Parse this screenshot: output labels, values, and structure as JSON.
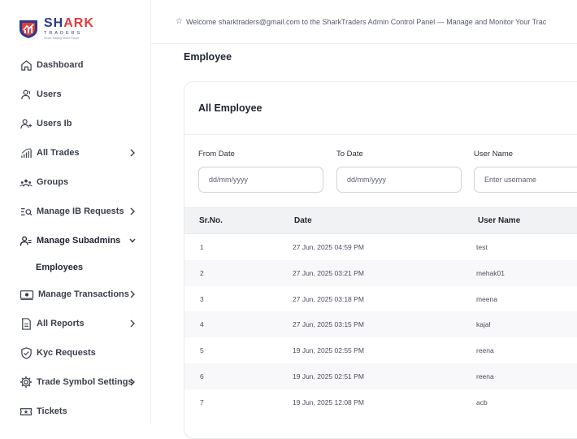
{
  "brand": {
    "title_a": "SH",
    "title_b": "ARK",
    "subtitle": "TRADERS",
    "tagline": "Smart Trading Smart Future"
  },
  "sidebar": {
    "items": [
      {
        "label": "Dashboard",
        "icon": "home-icon",
        "chevron": false
      },
      {
        "label": "Users",
        "icon": "users-icon",
        "chevron": false
      },
      {
        "label": "Users Ib",
        "icon": "user-add-icon",
        "chevron": false
      },
      {
        "label": "All Trades",
        "icon": "bar-chart-icon",
        "chevron": true
      },
      {
        "label": "Groups",
        "icon": "groups-icon",
        "chevron": false
      },
      {
        "label": "Manage IB Requests",
        "icon": "list-search-icon",
        "chevron": true
      },
      {
        "label": "Manage Subadmins",
        "icon": "subadmin-icon",
        "chevron": "down"
      },
      {
        "label": "Employees",
        "icon": "",
        "chevron": false,
        "sub": true
      },
      {
        "label": "Manage Transactions",
        "icon": "money-icon",
        "chevron": true
      },
      {
        "label": "All Reports",
        "icon": "document-icon",
        "chevron": true
      },
      {
        "label": "Kyc Requests",
        "icon": "shield-check-icon",
        "chevron": false
      },
      {
        "label": "Trade Symbol Settings",
        "icon": "gear-icon",
        "chevron": true
      },
      {
        "label": "Tickets",
        "icon": "ticket-icon",
        "chevron": false
      }
    ]
  },
  "topbar": {
    "message": "Welcome sharktraders@gmail.com to the SharkTraders Admin Control Panel — Manage and Monitor Your Trac"
  },
  "page": {
    "title": "Employee"
  },
  "card": {
    "title": "All Employee",
    "filters": {
      "from_label": "From Date",
      "from_placeholder": "dd/mm/yyyy",
      "to_label": "To Date",
      "to_placeholder": "dd/mm/yyyy",
      "user_label": "User Name",
      "user_placeholder": "Enter username"
    },
    "table": {
      "headers": [
        "Sr.No.",
        "Date",
        "User Name"
      ],
      "rows": [
        [
          "1",
          "27 Jun, 2025 04:59 PM",
          "test"
        ],
        [
          "2",
          "27 Jun, 2025 03:21 PM",
          "mehak01"
        ],
        [
          "3",
          "27 Jun, 2025 03:18 PM",
          "meena"
        ],
        [
          "4",
          "27 Jun, 2025 03:15 PM",
          "kajal"
        ],
        [
          "5",
          "19 Jun, 2025 02:55 PM",
          "reena"
        ],
        [
          "6",
          "19 Jun, 2025 02:51 PM",
          "reena"
        ],
        [
          "7",
          "19 Jun, 2025 12:08 PM",
          "acb"
        ]
      ]
    }
  },
  "colors": {
    "brand_blue": "#2b3a8c",
    "brand_red": "#e23b3b",
    "header_bg": "#f1f2f4"
  }
}
